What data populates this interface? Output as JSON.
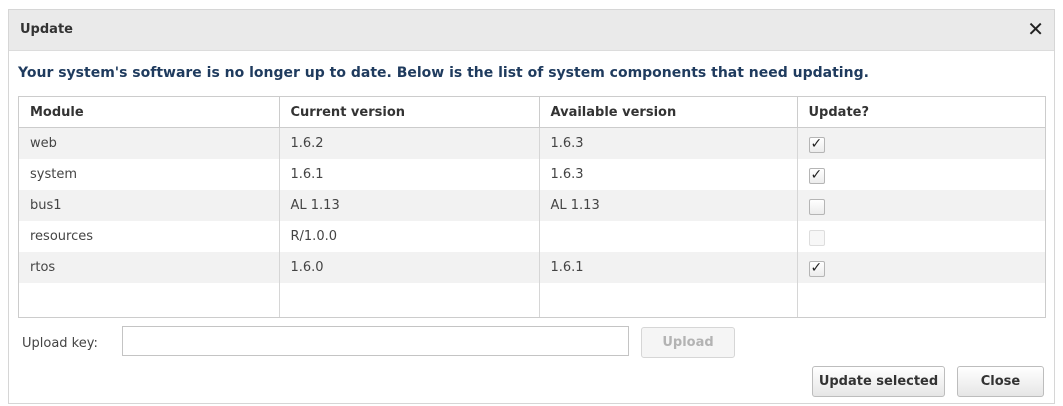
{
  "dialog": {
    "title": "Update",
    "close_icon": "close-icon",
    "message": "Your system's software is no longer up to date. Below is the list of system components that need updating."
  },
  "table": {
    "headers": [
      "Module",
      "Current version",
      "Available version",
      "Update?"
    ],
    "rows": [
      {
        "module": "web",
        "current": "1.6.2",
        "available": "1.6.3",
        "update": "checked"
      },
      {
        "module": "system",
        "current": "1.6.1",
        "available": "1.6.3",
        "update": "checked"
      },
      {
        "module": "bus1",
        "current": "AL 1.13",
        "available": "AL 1.13",
        "update": "unchecked"
      },
      {
        "module": "resources",
        "current": "R/1.0.0",
        "available": "",
        "update": "disabled"
      },
      {
        "module": "rtos",
        "current": "1.6.0",
        "available": "1.6.1",
        "update": "checked"
      }
    ]
  },
  "upload": {
    "label": "Upload key:",
    "value": "",
    "placeholder": "",
    "button_label": "Upload"
  },
  "footer": {
    "update_selected_label": "Update selected",
    "close_label": "Close"
  }
}
